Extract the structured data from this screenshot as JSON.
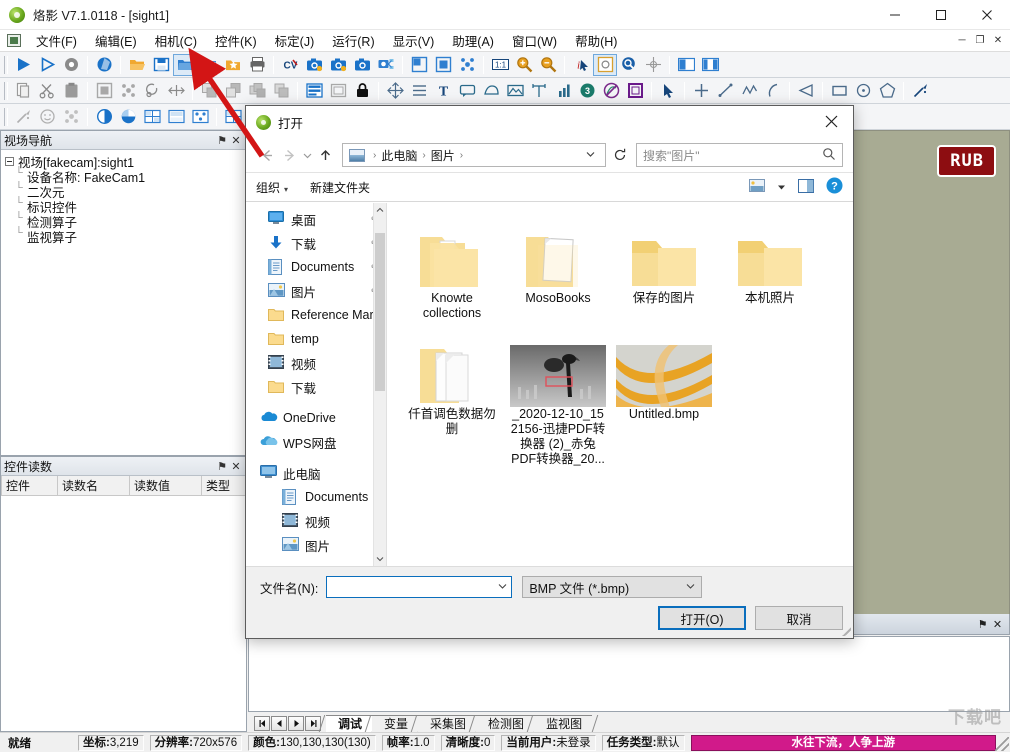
{
  "window": {
    "title": "烙影 V7.1.0118 - [sight1]",
    "icon": "app-logo-icon",
    "buttons": [
      {
        "name": "minimize",
        "glyph": "─"
      },
      {
        "name": "maximize",
        "glyph": "☐"
      },
      {
        "name": "close",
        "glyph": "✕"
      }
    ]
  },
  "menubar": {
    "items": [
      {
        "label": "文件(F)"
      },
      {
        "label": "编辑(E)"
      },
      {
        "label": "相机(C)"
      },
      {
        "label": "控件(K)"
      },
      {
        "label": "标定(J)"
      },
      {
        "label": "运行(R)"
      },
      {
        "label": "显示(V)"
      },
      {
        "label": "助理(A)"
      },
      {
        "label": "窗口(W)"
      },
      {
        "label": "帮助(H)"
      }
    ],
    "right_buttons": [
      {
        "name": "doc-minimize",
        "glyph": "─"
      },
      {
        "name": "doc-restore",
        "glyph": "❐"
      },
      {
        "name": "doc-close",
        "glyph": "✕"
      }
    ]
  },
  "toolbars": {
    "row1": [
      {
        "name": "run-icon",
        "kind": "play",
        "color": "#1a72c8"
      },
      {
        "name": "step-run-icon",
        "kind": "play-outline",
        "color": "#1a72c8"
      },
      {
        "name": "stop-icon",
        "kind": "circle",
        "color": "#8a8a8a"
      },
      {
        "name": "sep"
      },
      {
        "name": "refresh-icon",
        "kind": "shutter",
        "color": "#1a72c8"
      },
      {
        "name": "sep"
      },
      {
        "name": "open-folder-icon",
        "kind": "folder-open",
        "color": "#f0a830"
      },
      {
        "name": "save-icon",
        "kind": "save",
        "color": "#1a72c8"
      },
      {
        "name": "open-image-icon",
        "kind": "folder-blue",
        "color": "#2f7fd0",
        "active": true
      },
      {
        "name": "save-image-icon",
        "kind": "folder-img",
        "color": "#2f7fd0"
      },
      {
        "name": "favorite-folder-icon",
        "kind": "folder-star",
        "color": "#f0a830"
      },
      {
        "name": "print-icon",
        "kind": "printer",
        "color": "#666666"
      },
      {
        "name": "sep"
      },
      {
        "name": "cv-icon",
        "kind": "text-cv",
        "color": "#16457a"
      },
      {
        "name": "camera-add-icon",
        "kind": "camera",
        "color": "#1a72c8"
      },
      {
        "name": "camera-settings-icon",
        "kind": "camera",
        "color": "#1a72c8"
      },
      {
        "name": "camera-capture-icon",
        "kind": "camera2",
        "color": "#1a72c8"
      },
      {
        "name": "camera-network-icon",
        "kind": "camera-net",
        "color": "#2f7fd0"
      },
      {
        "name": "sep"
      },
      {
        "name": "fit-window-icon",
        "kind": "sq-corner",
        "color": "#2f7fd0"
      },
      {
        "name": "actual-size-icon",
        "kind": "sq-fill",
        "color": "#2f7fd0"
      },
      {
        "name": "fullscreen-icon",
        "kind": "sq-dots",
        "color": "#2f7fd0"
      },
      {
        "name": "sep"
      },
      {
        "name": "one-to-one-icon",
        "kind": "one-one",
        "color": "#16457a"
      },
      {
        "name": "zoom-in-icon",
        "kind": "magnify-plus",
        "color": "#e8a020"
      },
      {
        "name": "zoom-out-icon",
        "kind": "magnify-minus",
        "color": "#e8a020"
      },
      {
        "name": "sep"
      },
      {
        "name": "info-cursor-icon",
        "kind": "i-arrow",
        "color": "#c01c1c"
      },
      {
        "name": "region-icon",
        "kind": "sq-outline",
        "color": "#d8a030",
        "active": true
      },
      {
        "name": "search-region-icon",
        "kind": "magnify-circle",
        "color": "#1a5fa8"
      },
      {
        "name": "crosshair-icon",
        "kind": "crosshair",
        "color": "#999999"
      },
      {
        "name": "sep"
      },
      {
        "name": "split-view-icon",
        "kind": "split-h",
        "color": "#2f7fd0"
      },
      {
        "name": "panel-view-icon",
        "kind": "split-v",
        "color": "#2f7fd0"
      }
    ],
    "row2": [
      {
        "name": "copy-icon",
        "kind": "copy",
        "color": "#9a9a9a"
      },
      {
        "name": "cut-icon",
        "kind": "scissors",
        "color": "#8a8a8a"
      },
      {
        "name": "paste-icon",
        "kind": "clipboard",
        "color": "#9a9a9a"
      },
      {
        "name": "sep"
      },
      {
        "name": "select-all-icon",
        "kind": "sq-fill",
        "color": "#a8a8a8"
      },
      {
        "name": "select-grid-icon",
        "kind": "sq-dots",
        "color": "#a8a8a8"
      },
      {
        "name": "rotate-icon",
        "kind": "rotate",
        "color": "#8a8a8a"
      },
      {
        "name": "align-icon",
        "kind": "arrows-h",
        "color": "#8a8a8a"
      },
      {
        "name": "sep"
      },
      {
        "name": "bring-front-icon",
        "kind": "layer-front",
        "color": "#a8a8a8"
      },
      {
        "name": "send-back-icon",
        "kind": "layer-back",
        "color": "#a8a8a8"
      },
      {
        "name": "group-icon",
        "kind": "layer-group",
        "color": "#a8a8a8"
      },
      {
        "name": "arrange-icon",
        "kind": "layer-mid",
        "color": "#a8a8a8"
      },
      {
        "name": "sep"
      },
      {
        "name": "list-view-icon",
        "kind": "list-blue",
        "color": "#1a72c8"
      },
      {
        "name": "frame-icon",
        "kind": "frame",
        "color": "#a8a8a8"
      },
      {
        "name": "lock-icon",
        "kind": "lock",
        "color": "#111111"
      },
      {
        "name": "sep"
      },
      {
        "name": "resize-icon",
        "kind": "arrows-cross",
        "color": "#4a6a8a"
      },
      {
        "name": "lines-icon",
        "kind": "lines",
        "color": "#4a6a8a"
      },
      {
        "name": "text-tool-icon",
        "kind": "letter-T",
        "color": "#16457a"
      },
      {
        "name": "balloon-icon",
        "kind": "balloon",
        "color": "#2a6a8a"
      },
      {
        "name": "shape-icon",
        "kind": "blob",
        "color": "#2a6a8a"
      },
      {
        "name": "image-tool-icon",
        "kind": "image",
        "color": "#2a6a8a"
      },
      {
        "name": "measure-icon",
        "kind": "measure",
        "color": "#2a6a8a"
      },
      {
        "name": "chart-icon",
        "kind": "bars",
        "color": "#2a6a8a"
      },
      {
        "name": "count-badge-icon",
        "kind": "badge3",
        "color": "#1a7a6a"
      },
      {
        "name": "disable-icon",
        "kind": "no-circle",
        "color": "#7a2a8a"
      },
      {
        "name": "roi-icon",
        "kind": "sq-purple",
        "color": "#6a1a8a"
      },
      {
        "name": "sep"
      },
      {
        "name": "pointer-icon",
        "kind": "cursor",
        "color": "#16457a"
      },
      {
        "name": "sep"
      },
      {
        "name": "point-tool-icon",
        "kind": "plus",
        "color": "#4a6a8a"
      },
      {
        "name": "line-tool-icon",
        "kind": "line",
        "color": "#4a6a8a"
      },
      {
        "name": "polyline-tool-icon",
        "kind": "polyline",
        "color": "#4a6a8a"
      },
      {
        "name": "arc-tool-icon",
        "kind": "arc",
        "color": "#4a6a8a"
      },
      {
        "name": "sep"
      },
      {
        "name": "triangle-tool-icon",
        "kind": "triangle",
        "color": "#4a6a8a"
      },
      {
        "name": "sep"
      },
      {
        "name": "rect-tool-icon",
        "kind": "rect",
        "color": "#4a6a8a"
      },
      {
        "name": "circle-tool-icon",
        "kind": "circle-dot",
        "color": "#4a6a8a"
      },
      {
        "name": "polygon-tool-icon",
        "kind": "pentagon",
        "color": "#4a6a8a"
      },
      {
        "name": "sep"
      },
      {
        "name": "magic-wand-icon",
        "kind": "wand",
        "color": "#16457a"
      }
    ],
    "row3": [
      {
        "name": "wand-tool-icon",
        "kind": "wand",
        "color": "#b0b0b0"
      },
      {
        "name": "smiley-icon",
        "kind": "smiley",
        "color": "#b0b0b0"
      },
      {
        "name": "matrix-icon",
        "kind": "sq-dots",
        "color": "#c0c0c0"
      },
      {
        "name": "sep"
      },
      {
        "name": "contrast-icon",
        "kind": "half-circle",
        "color": "#1a72c8"
      },
      {
        "name": "color-wheel-icon",
        "kind": "pie",
        "color": "#1a72c8"
      },
      {
        "name": "grid-blue-icon",
        "kind": "grid-blue",
        "color": "#2f7fd0"
      },
      {
        "name": "template-icon",
        "kind": "template",
        "color": "#2f7fd0"
      },
      {
        "name": "pattern-icon",
        "kind": "pattern",
        "color": "#2f7fd0"
      },
      {
        "name": "sep"
      },
      {
        "name": "table-tool-icon",
        "kind": "grid-blue",
        "color": "#2f7fd0"
      }
    ]
  },
  "nav_panel": {
    "title": "视场导航",
    "pin_glyph": "⚑",
    "close_glyph": "✕",
    "root": "视场[fakecam]:sight1",
    "children": [
      {
        "label": "设备名称: FakeCam1"
      },
      {
        "label": "二次元"
      },
      {
        "label": "标识控件"
      },
      {
        "label": "检测算子"
      },
      {
        "label": "监视算子"
      }
    ]
  },
  "readings_panel": {
    "title": "控件读数",
    "pin_glyph": "⚑",
    "close_glyph": "✕",
    "columns": [
      "控件",
      "读数名",
      "读数值",
      "类型"
    ],
    "rows": []
  },
  "canvas": {
    "badge": "RUB",
    "badge_bg": "#8d0d11",
    "background": "#a8ab93",
    "pin_glyph": "⚑",
    "close_glyph": "✕"
  },
  "bottom_tabs": {
    "nav_buttons": [
      "⏮",
      "◀",
      "▶",
      "⏭"
    ],
    "tabs": [
      {
        "label": "调试",
        "selected": true
      },
      {
        "label": "变量",
        "selected": false
      },
      {
        "label": "采集图",
        "selected": false
      },
      {
        "label": "检测图",
        "selected": false
      },
      {
        "label": "监视图",
        "selected": false
      }
    ]
  },
  "statusbar": {
    "ready": "就绪",
    "cells": [
      {
        "key": "坐标:",
        "value": "3,219"
      },
      {
        "key": "分辨率:",
        "value": "720x576"
      },
      {
        "key": "颜色:",
        "value": "130,130,130(130)"
      },
      {
        "key": "帧率:",
        "value": "1.0"
      },
      {
        "key": "清晰度:",
        "value": "0"
      },
      {
        "key": "当前用户:",
        "value": "未登录"
      },
      {
        "key": "任务类型:",
        "value": "默认"
      }
    ],
    "marquee": "水往下流，人争上游",
    "marquee_bg": "#d11a8a"
  },
  "watermark": "下载吧",
  "dialog": {
    "title": "打开",
    "icon": "app-logo-icon",
    "close_glyph": "✕",
    "nav": {
      "back_glyph": "←",
      "forward_glyph": "→",
      "recent_glyph": "⌄",
      "up_glyph": "↑",
      "refresh_glyph": "↻",
      "dropdown_glyph": "⌄"
    },
    "breadcrumb": {
      "icon": "pictures-icon",
      "segments": [
        "此电脑",
        "图片"
      ],
      "separator": "›"
    },
    "search": {
      "placeholder": "搜索\"图片\"",
      "icon": "search-icon"
    },
    "commands": {
      "organize": "组织",
      "new_folder": "新建文件夹",
      "view_icon": "view-mode-icon",
      "view_caret": "▾",
      "preview_icon": "preview-pane-icon",
      "help_icon": "help-icon"
    },
    "sidebar": [
      {
        "label": "桌面",
        "icon": "desktop-icon",
        "pinned": true
      },
      {
        "label": "下载",
        "icon": "download-icon",
        "pinned": true
      },
      {
        "label": "Documents",
        "icon": "documents-icon",
        "pinned": true
      },
      {
        "label": "图片",
        "icon": "pictures-icon",
        "pinned": true
      },
      {
        "label": "Reference Mar",
        "icon": "folder-icon",
        "pinned": false
      },
      {
        "label": "temp",
        "icon": "folder-icon",
        "pinned": false
      },
      {
        "label": "视频",
        "icon": "video-icon",
        "pinned": false
      },
      {
        "label": "下载",
        "icon": "folder-icon",
        "pinned": false
      },
      {
        "label": "OneDrive",
        "icon": "onedrive-icon",
        "pinned": false,
        "group": true
      },
      {
        "label": "WPS网盘",
        "icon": "wps-cloud-icon",
        "pinned": false,
        "group": true
      },
      {
        "label": "此电脑",
        "icon": "computer-icon",
        "pinned": false,
        "group": true
      },
      {
        "label": "Documents",
        "icon": "documents-icon",
        "pinned": false,
        "indent": true
      },
      {
        "label": "视频",
        "icon": "video-icon",
        "pinned": false,
        "indent": true
      },
      {
        "label": "图片",
        "icon": "pictures-icon",
        "pinned": false,
        "indent": true
      }
    ],
    "files": [
      {
        "label": "Knowte collections",
        "type": "folder-docs"
      },
      {
        "label": "MosoBooks",
        "type": "folder-doc"
      },
      {
        "label": "保存的图片",
        "type": "folder"
      },
      {
        "label": "本机照片",
        "type": "folder"
      },
      {
        "label": "仟首调色数据勿删",
        "type": "folder-papers"
      },
      {
        "label": "_2020-12-10_15 2156-迅捷PDF转换器 (2)_赤兔PDF转换器_20...",
        "type": "image-dark"
      },
      {
        "label": "Untitled.bmp",
        "type": "image-swirl"
      }
    ],
    "footer": {
      "filename_label": "文件名(N):",
      "filename_value": "",
      "filename_caret": "⌄",
      "filetype_value": "BMP 文件 (*.bmp)",
      "filetype_caret": "⌄",
      "open_button": "打开(O)",
      "cancel_button": "取消"
    }
  }
}
